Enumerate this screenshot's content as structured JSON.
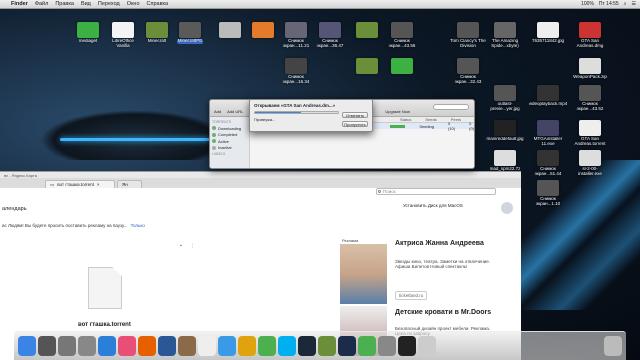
{
  "menubar": {
    "app": "Finder",
    "items": [
      "Файл",
      "Правка",
      "Вид",
      "Переход",
      "Окно",
      "Справка"
    ],
    "clock": "Пт 14:55",
    "battery": "100%"
  },
  "desktop": {
    "icons": [
      {
        "label": "mediaget",
        "color": "#3cb043",
        "col": 88,
        "row": 12
      },
      {
        "label": "LibreOffice Vanilla",
        "color": "#f4f4f4",
        "col": 123,
        "row": 12
      },
      {
        "label": "Minecraft",
        "color": "#6b8e3a",
        "col": 157,
        "row": 12
      },
      {
        "label": "MinecraftPE",
        "color": "#5a5a5a",
        "col": 190,
        "row": 12,
        "selected": true
      },
      {
        "label": "",
        "color": "#bbb",
        "col": 230,
        "row": 12
      },
      {
        "label": "",
        "color": "#e57a2a",
        "col": 263,
        "row": 12
      },
      {
        "label": "Снимок экран...11.21",
        "color": "#667",
        "col": 296,
        "row": 12
      },
      {
        "label": "Снимок экран...36.47",
        "color": "#557",
        "col": 330,
        "row": 12
      },
      {
        "label": "",
        "color": "#6b8e3a",
        "col": 367,
        "row": 12
      },
      {
        "label": "Снимок экран...43.55",
        "color": "#555",
        "col": 402,
        "row": 12
      },
      {
        "label": "Tom Clancy's The Division",
        "color": "#555",
        "col": 468,
        "row": 12
      },
      {
        "label": "The Amazing Spide...xbyte)",
        "color": "#666",
        "col": 505,
        "row": 12
      },
      {
        "label": "7635711842.jpg",
        "color": "#eee",
        "col": 548,
        "row": 12
      },
      {
        "label": "GTA San Andreas.dmg",
        "color": "#c33",
        "col": 590,
        "row": 12
      },
      {
        "label": "Снимок экран...16.34",
        "color": "#444",
        "col": 296,
        "row": 48
      },
      {
        "label": "",
        "color": "#6b8e3a",
        "col": 367,
        "row": 48
      },
      {
        "label": "",
        "color": "#3cb043",
        "col": 402,
        "row": 48
      },
      {
        "label": "Снимок экран...32.43",
        "color": "#555",
        "col": 468,
        "row": 48
      },
      {
        "label": "WeaponPack.zip",
        "color": "#ddd",
        "col": 590,
        "row": 48
      },
      {
        "label": "outlast-previe...yer.jpg",
        "color": "#555",
        "col": 505,
        "row": 75
      },
      {
        "label": "videoplayback.mp4",
        "color": "#333",
        "col": 548,
        "row": 75
      },
      {
        "label": "Снимок экран...43.52",
        "color": "#555",
        "col": 590,
        "row": 75
      },
      {
        "label": "mainreddefault.jpg",
        "color": "#222",
        "col": 505,
        "row": 110
      },
      {
        "label": "MTGAinstaller 11.exe",
        "color": "#446",
        "col": 548,
        "row": 110
      },
      {
        "label": "GTA San Andreas.torrent",
        "color": "#eee",
        "col": 590,
        "row": 110
      },
      {
        "label": "mad_spm22.7z",
        "color": "#ddd",
        "col": 505,
        "row": 140
      },
      {
        "label": "Снимок экран...51.44",
        "color": "#333",
        "col": 548,
        "row": 140
      },
      {
        "label": "sl-2-00-installer.exe",
        "color": "#ddd",
        "col": 590,
        "row": 140
      },
      {
        "label": "Снимок экран...1.10",
        "color": "#555",
        "col": 548,
        "row": 170
      }
    ]
  },
  "torrent_window": {
    "toolbar": [
      "Add",
      "Add URL",
      "Create",
      "Upgrade Now"
    ],
    "sidebar_header": "TORRENTS",
    "sidebar_items": [
      "Downloading",
      "Completed",
      "Active",
      "Inactive"
    ],
    "labels_header": "LABELS",
    "columns": [
      "Status",
      "Seeds",
      "Peers"
    ],
    "row": {
      "status": "Seeding",
      "seeds": "0 (10)",
      "peers": "0 (0)"
    },
    "progress_label": "0.0 KB/s"
  },
  "dialog": {
    "title": "Открываем «GTA San Andreas.dm...»",
    "status": "Проверка...",
    "cancel": "Отменить",
    "skip": "Пропустить",
    "progress": 0.55
  },
  "browser": {
    "top_label": "вх - Яндекс.Карта",
    "tab_active": "вот гташка.torrent",
    "tab_other": "Ян",
    "address_placeholder": "Поиск",
    "crumb": "алендарь",
    "install_link": "Установить Диск для MacOS",
    "notice": "ас Людям! Вы будете просить поставить рекламу на паузу...",
    "notice_close": "Только",
    "file_name": "вот гташка.torrent",
    "ad": {
      "tag": "Реклама",
      "title1": "Актриса Жанна Андреева",
      "body1": "Звезды кино, театра. Заметки на отвлечение. Афиша Билетов Новый спектакль!",
      "site": "ticketland.ru",
      "title2": "Детские кровати в Mr.Doors",
      "body2": "Безопасный дизайн проект мебели. Реклама. Цена по запросу."
    }
  },
  "dock": {
    "apps": [
      {
        "name": "finder",
        "color": "#3a84e6"
      },
      {
        "name": "launchpad",
        "color": "#555"
      },
      {
        "name": "mission-control",
        "color": "#777"
      },
      {
        "name": "trash-mini",
        "color": "#888"
      },
      {
        "name": "app-store",
        "color": "#2b7fd9"
      },
      {
        "name": "music",
        "color": "#e94e77"
      },
      {
        "name": "firefox",
        "color": "#e66000"
      },
      {
        "name": "word",
        "color": "#2b5797"
      },
      {
        "name": "contacts",
        "color": "#8b6a4a"
      },
      {
        "name": "calendar",
        "color": "#eee"
      },
      {
        "name": "safari",
        "color": "#3a9ae6"
      },
      {
        "name": "chrome",
        "color": "#dfa30f"
      },
      {
        "name": "utorrent",
        "color": "#4caf50"
      },
      {
        "name": "skype",
        "color": "#00aff0"
      },
      {
        "name": "steam",
        "color": "#1b2838"
      },
      {
        "name": "minecraft",
        "color": "#6b8e3a"
      },
      {
        "name": "photoshop",
        "color": "#1a2c4a"
      },
      {
        "name": "preview",
        "color": "#4caf50"
      },
      {
        "name": "settings",
        "color": "#888"
      },
      {
        "name": "terminal",
        "color": "#222"
      },
      {
        "name": "utilities",
        "color": "#ccc"
      },
      {
        "name": "trash",
        "color": "#bbb"
      }
    ]
  }
}
